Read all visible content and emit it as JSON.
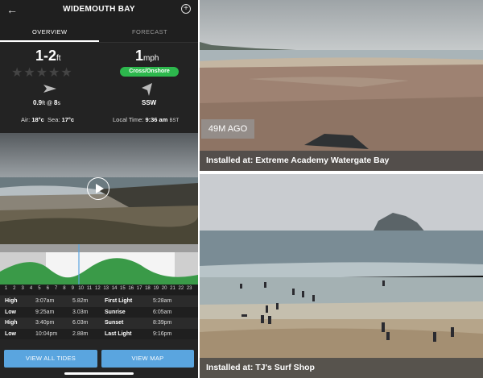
{
  "header": {
    "title": "WIDEMOUTH BAY",
    "back_icon": "back-arrow-icon",
    "add_icon": "plus-circle-icon"
  },
  "tabs": [
    {
      "label": "OVERVIEW",
      "active": true
    },
    {
      "label": "FORECAST",
      "active": false
    }
  ],
  "surf": {
    "height": "1-2",
    "height_unit": "ft",
    "rating": 0,
    "rating_max": 5,
    "swell_height": "0.9",
    "swell_height_unit": "ft",
    "swell_at": " @ ",
    "swell_period": "8",
    "swell_period_unit": "s",
    "wind_speed": "1",
    "wind_unit": "mph",
    "wind_type": "Cross/Onshore",
    "wind_direction": "SSW",
    "air_label": "Air:",
    "air_temp": "18°c",
    "sea_label": "Sea:",
    "sea_temp": "17°c",
    "time_label": "Local Time:",
    "local_time": "9:36 am",
    "timezone": "BST"
  },
  "tide_hours": [
    "1",
    "2",
    "3",
    "4",
    "5",
    "6",
    "7",
    "8",
    "9",
    "10",
    "11",
    "12",
    "13",
    "14",
    "15",
    "16",
    "17",
    "18",
    "19",
    "20",
    "21",
    "22",
    "23"
  ],
  "tides": [
    {
      "type": "High",
      "time": "3:07am",
      "height": "5.82m",
      "event": "First Light",
      "event_time": "5:28am"
    },
    {
      "type": "Low",
      "time": "9:25am",
      "height": "3.03m",
      "event": "Sunrise",
      "event_time": "6:05am"
    },
    {
      "type": "High",
      "time": "3:40pm",
      "height": "6.03m",
      "event": "Sunset",
      "event_time": "8:39pm"
    },
    {
      "type": "Low",
      "time": "10:04pm",
      "height": "2.88m",
      "event": "Last Light",
      "event_time": "9:16pm"
    }
  ],
  "buttons": {
    "view_all_tides": "VIEW ALL TIDES",
    "view_map": "VIEW MAP"
  },
  "cams": {
    "top": {
      "ago": "49M AGO",
      "installed": "Installed at: Extreme Academy Watergate Bay"
    },
    "bottom": {
      "installed": "Installed at: TJ's Surf Shop"
    }
  },
  "colors": {
    "wind_badge": "#2db84d",
    "button": "#5aa5df",
    "tide_fill": "#3a9a48"
  }
}
